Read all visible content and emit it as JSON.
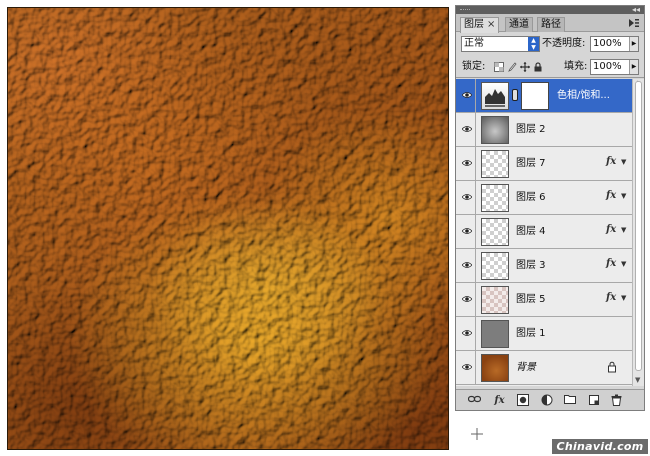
{
  "panel": {
    "tabs": [
      {
        "label": "图层",
        "close": "×",
        "active": true
      },
      {
        "label": "通道",
        "active": false
      },
      {
        "label": "路径",
        "active": false
      }
    ],
    "menu_icon": "panel-menu-icon",
    "collapse_glyph": "◂◂",
    "blend_mode": "正常",
    "opacity_label": "不透明度:",
    "opacity_value": "100%",
    "lock_label": "锁定:",
    "fill_label": "填充:",
    "fill_value": "100%"
  },
  "layers": [
    {
      "name": "色相/饱和...",
      "thumb": "adjustment",
      "has_mask": true,
      "selected": true,
      "fx": false,
      "locked": false
    },
    {
      "name": "图层 2",
      "thumb": "gray-blur",
      "fx": false
    },
    {
      "name": "图层 7",
      "thumb": "transparent",
      "fx": true
    },
    {
      "name": "图层 6",
      "thumb": "transparent",
      "fx": true
    },
    {
      "name": "图层 4",
      "thumb": "transparent",
      "fx": true
    },
    {
      "name": "图层 3",
      "thumb": "transparent",
      "fx": true
    },
    {
      "name": "图层 5",
      "thumb": "transparent-tinted",
      "fx": true
    },
    {
      "name": "图层 1",
      "thumb": "gray-flat",
      "fx": false
    },
    {
      "name": "背景",
      "thumb": "brown",
      "fx": false,
      "locked": true,
      "italic": true
    }
  ],
  "fx_label": "fx",
  "bottom_toolbar": {
    "fx_label": "fx",
    "icons": [
      "link-layers-icon",
      "layer-style-icon",
      "add-mask-icon",
      "adjustment-layer-icon",
      "new-group-icon",
      "new-layer-icon",
      "delete-layer-icon"
    ]
  },
  "watermark": "Chinavid.com",
  "colors": {
    "selected_row": "#3468c8",
    "canvas_base": "#a85a18",
    "canvas_highlight": "#eeac2a"
  }
}
